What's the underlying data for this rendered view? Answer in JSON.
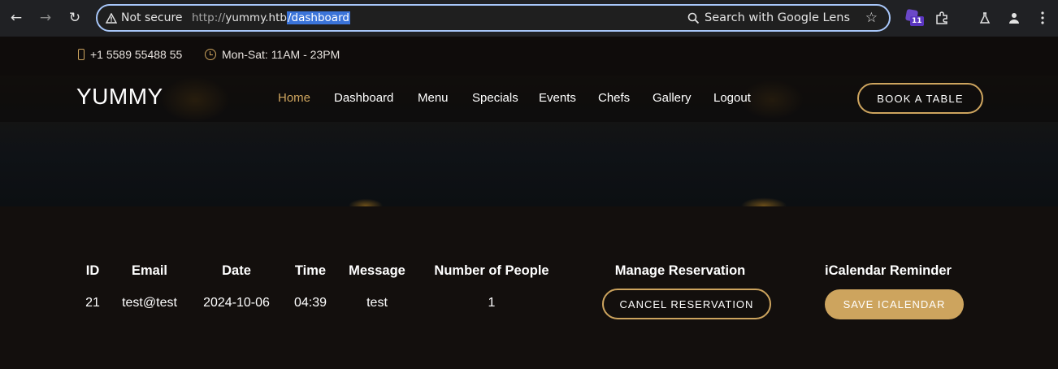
{
  "browser": {
    "security_label": "Not secure",
    "url_scheme": "http://",
    "url_host": "yummy.htb",
    "url_path": "/dashboard",
    "lens_label": "Search with Google Lens",
    "extension_badge": "11"
  },
  "topbar": {
    "phone": "+1 5589 55488 55",
    "hours": "Mon-Sat: 11AM - 23PM"
  },
  "header": {
    "logo": "YUMMY",
    "nav": [
      "Home",
      "Dashboard",
      "Menu",
      "Specials",
      "Events",
      "Chefs",
      "Gallery",
      "Logout"
    ],
    "book_button": "BOOK A TABLE"
  },
  "table": {
    "columns": [
      "ID",
      "Email",
      "Date",
      "Time",
      "Message",
      "Number of People",
      "Manage Reservation",
      "iCalendar Reminder"
    ],
    "rows": [
      {
        "id": "21",
        "email": "test@test",
        "date": "2024-10-06",
        "time": "04:39",
        "message": "test",
        "people": "1",
        "cancel_label": "CANCEL RESERVATION",
        "save_label": "SAVE ICALENDAR"
      }
    ]
  },
  "colors": {
    "accent": "#cda45e",
    "background": "#130f0d"
  }
}
